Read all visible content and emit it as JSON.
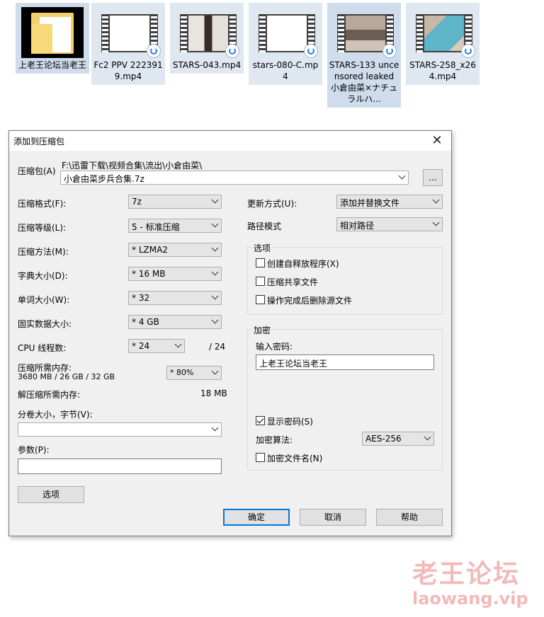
{
  "files": [
    {
      "name": "上老王论坛当老王",
      "type": "folder"
    },
    {
      "name": "Fc2 PPV 2223919.mp4",
      "type": "video"
    },
    {
      "name": "STARS-043.mp4",
      "type": "video"
    },
    {
      "name": "stars-080-C.mp4",
      "type": "video"
    },
    {
      "name": "STARS-133 uncensored leaked 小倉由菜×ナチュラルハ...",
      "type": "video"
    },
    {
      "name": "STARS-258_x264.mp4",
      "type": "video"
    }
  ],
  "dialog": {
    "title": "添加到压缩包",
    "close": "✕",
    "archive_label": "压缩包(A)",
    "archive_path": "F:\\迅雷下载\\视频合集\\流出\\小倉由菜\\",
    "archive_name": "小倉由菜步兵合集.7z",
    "browse_label": "...",
    "left": {
      "format_label": "压缩格式(F):",
      "format_value": "7z",
      "level_label": "压缩等级(L):",
      "level_value": "5 - 标准压缩",
      "method_label": "压缩方法(M):",
      "method_value": "* LZMA2",
      "dict_label": "字典大小(D):",
      "dict_value": "* 16 MB",
      "word_label": "单词大小(W):",
      "word_value": "* 32",
      "solid_label": "固实数据大小:",
      "solid_value": "* 4 GB",
      "cpu_label": "CPU 线程数:",
      "cpu_value": "* 24",
      "cpu_max": "/ 24",
      "mem_label": "压缩所需内存:",
      "mem_detail": "3680 MB / 26 GB / 32 GB",
      "mem_value": "* 80%",
      "decomp_label": "解压缩所需内存:",
      "decomp_value": "18 MB",
      "volume_label": "分卷大小，字节(V):",
      "volume_value": "",
      "params_label": "参数(P):",
      "params_value": "",
      "options_button": "选项"
    },
    "right": {
      "update_label": "更新方式(U):",
      "update_value": "添加并替换文件",
      "path_label": "路径模式",
      "path_value": "相对路径",
      "options_group": "选项",
      "opt_sfx": "创建自释放程序(X)",
      "opt_sfx_checked": false,
      "opt_shared": "压缩共享文件",
      "opt_shared_checked": false,
      "opt_delete": "操作完成后删除源文件",
      "opt_delete_checked": false,
      "encrypt_group": "加密",
      "password_label": "输入密码:",
      "password_value": "上老王论坛当老王",
      "show_password": "显示密码(S)",
      "show_password_checked": true,
      "algo_label": "加密算法:",
      "algo_value": "AES-256",
      "encrypt_names": "加密文件名(N)",
      "encrypt_names_checked": false
    },
    "buttons": {
      "ok": "确定",
      "cancel": "取消",
      "help": "帮助"
    }
  },
  "watermark": {
    "line1": "老王论坛",
    "line2": "laowang.vip"
  }
}
